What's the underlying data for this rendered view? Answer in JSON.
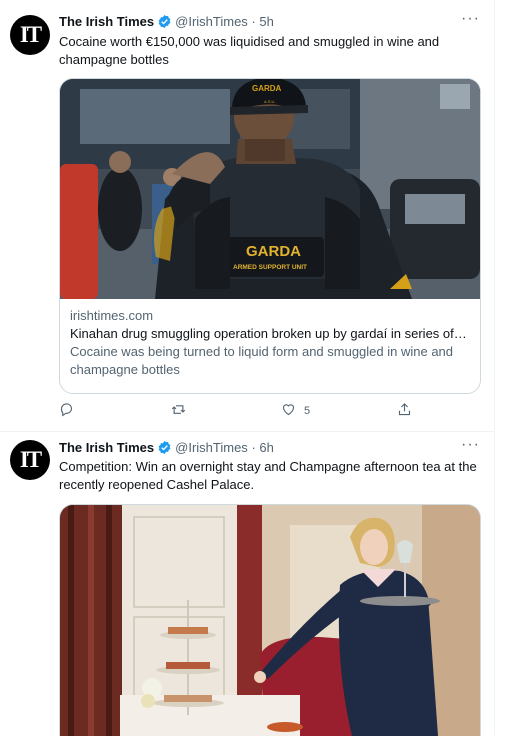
{
  "tweets": [
    {
      "author_name": "The Irish Times",
      "handle": "@IrishTimes",
      "separator": "·",
      "time": "5h",
      "avatar_text": "IT",
      "text": "Cocaine worth €150,000 was liquidised and smuggled in wine and champagne bottles",
      "card": {
        "domain": "irishtimes.com",
        "title": "Kinahan drug smuggling operation broken up by gardaí in series of Du...",
        "description": "Cocaine was being turned to liquid form and smuggled in wine and champagne bottles",
        "image_text": {
          "cap": "GARDA",
          "cap_sub": "A.S.U.",
          "vest_main": "GARDA",
          "vest_sub": "ARMED SUPPORT UNIT"
        }
      },
      "actions": {
        "reply_count": "",
        "retweet_count": "",
        "like_count": "5",
        "share_count": ""
      }
    },
    {
      "author_name": "The Irish Times",
      "handle": "@IrishTimes",
      "separator": "·",
      "time": "6h",
      "avatar_text": "IT",
      "text": "Competition: Win an overnight stay and Champagne afternoon tea at the recently reopened Cashel Palace."
    }
  ],
  "icons": [
    "verified-badge-icon",
    "more-options-icon",
    "reply-icon",
    "retweet-icon",
    "like-icon",
    "share-icon"
  ],
  "colors": {
    "verified_blue": "#1d9bf0",
    "text_primary": "#0f1419",
    "text_muted": "#536471",
    "border": "#cfd9de"
  }
}
